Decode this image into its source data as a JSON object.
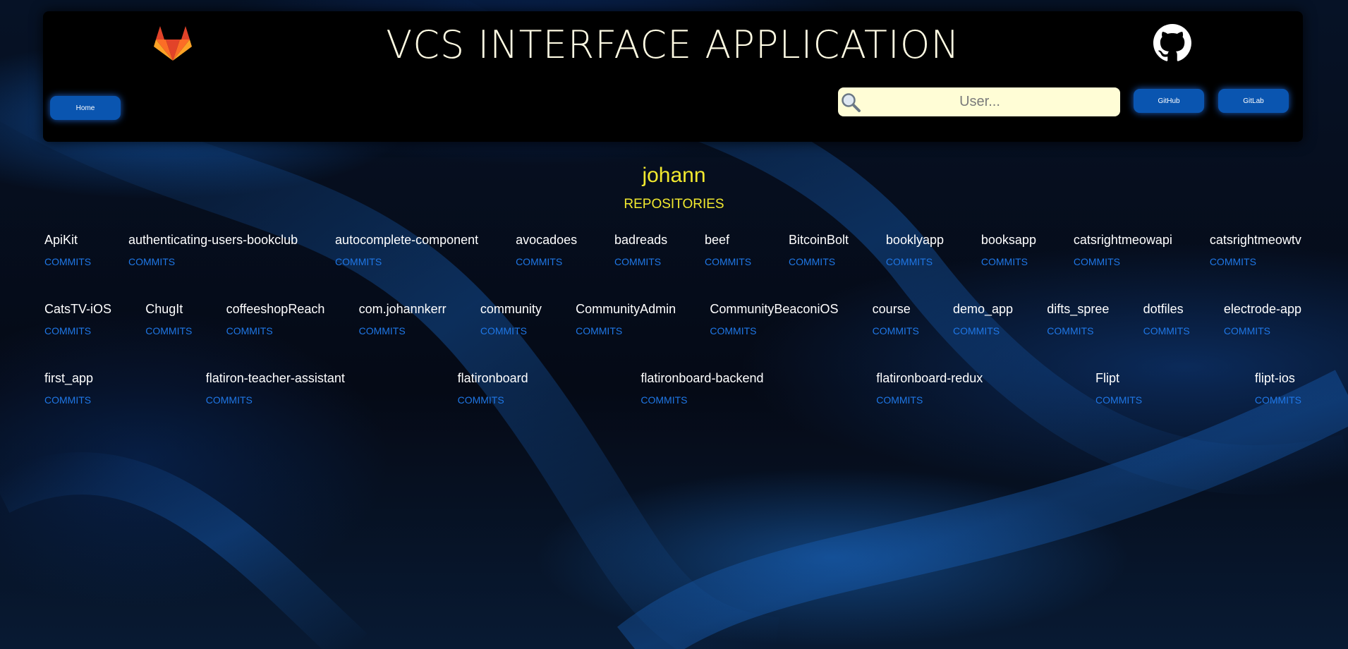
{
  "header": {
    "title": "VCS INTERFACE APPLICATION",
    "home_label": "Home",
    "github_label": "GitHub",
    "gitlab_label": "GitLab",
    "search_placeholder": "User..."
  },
  "user": {
    "name": "johann"
  },
  "repos_heading": "REPOSITORIES",
  "commits_label": "COMMITS",
  "repos": {
    "row1": [
      "ApiKit",
      "authenticating-users-bookclub",
      "autocomplete-component",
      "avocadoes",
      "badreads",
      "beef",
      "BitcoinBolt",
      "booklyapp",
      "booksapp",
      "catsrightmeowapi",
      "catsrightmeowtv"
    ],
    "row2": [
      "CatsTV-iOS",
      "ChugIt",
      "coffeeshopReach",
      "com.johannkerr",
      "community",
      "CommunityAdmin",
      "CommunityBeaconiOS",
      "course",
      "demo_app",
      "difts_spree",
      "dotfiles",
      "electrode-app"
    ],
    "row3": [
      "first_app",
      "flatiron-teacher-assistant",
      "flatironboard",
      "flatironboard-backend",
      "flatironboard-redux",
      "Flipt",
      "flipt-ios"
    ]
  },
  "colors": {
    "accent_yellow": "#f2e92f",
    "commit_link_blue": "#1f77e6",
    "button_blue": "#0a55b0",
    "search_bg": "#fffdd6"
  },
  "icons": [
    "gitlab-logo-icon",
    "github-logo-icon",
    "search-icon"
  ]
}
